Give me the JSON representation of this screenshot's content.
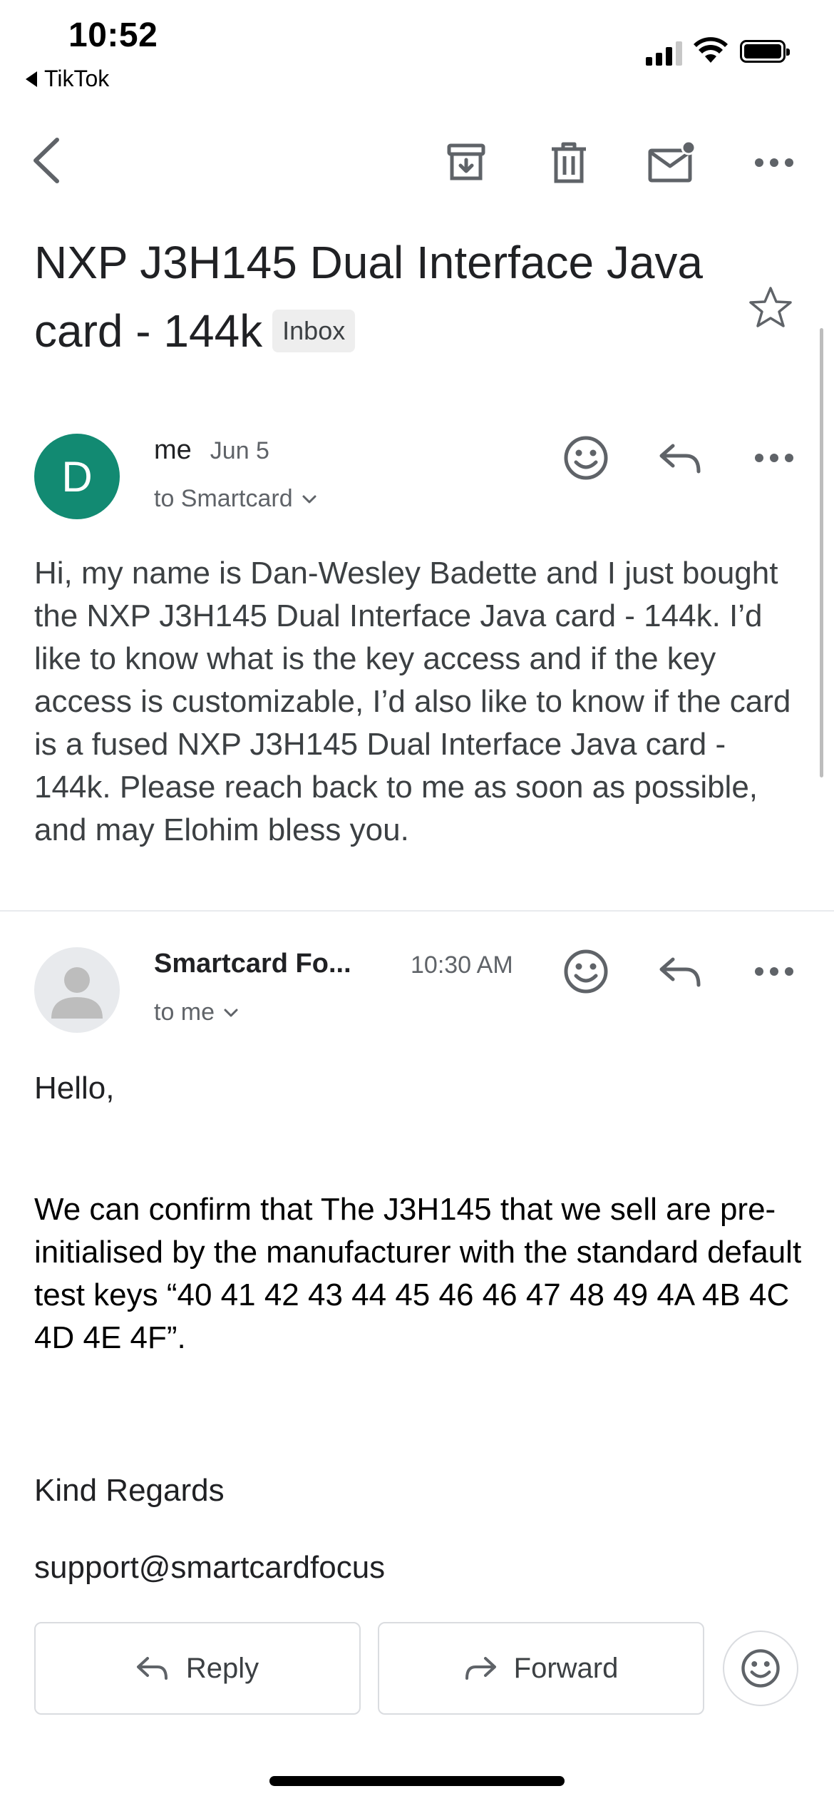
{
  "status_bar": {
    "time": "10:52",
    "back_app": "TikTok",
    "icons": [
      "cellular-signal-icon",
      "wifi-icon",
      "battery-icon"
    ]
  },
  "toolbar": {
    "icons": [
      "back-arrow-icon",
      "archive-icon",
      "trash-icon",
      "mark-unread-icon",
      "more-horizontal-icon"
    ]
  },
  "subject": {
    "line1": "NXP J3H145 Dual Interface Java",
    "line2": "card - 144k",
    "label": "Inbox"
  },
  "messages": [
    {
      "avatar_letter": "D",
      "avatar_color": "#128a72",
      "sender": "me",
      "date": "Jun 5",
      "recipient": "to Smartcard",
      "body": "Hi, my name is Dan-Wesley Badette and I just bought the NXP J3H145 Dual Interface Java card - 144k. I’d like to know what is the key access and if the key access is customizable, I’d also like to know if the card is a fused NXP J3H145 Dual Interface Java card - 144k. Please reach back to me as soon as possible, and may Elohim bless you."
    },
    {
      "sender": "Smartcard Fo...",
      "date": "10:30 AM",
      "recipient": "to me",
      "greeting": "Hello,",
      "paragraph": "We can confirm that The J3H145 that we sell are pre-initialised by the manufacturer with the standard default test keys “40 41 42 43 44 45 46 46 47 48 49 4A 4B 4C 4D 4E 4F”.",
      "signoff": "Kind Regards",
      "signature": "support@smartcardfocus"
    }
  ],
  "actions": {
    "reply": "Reply",
    "forward": "Forward"
  },
  "colors": {
    "accent_avatar": "#128a72",
    "icon_gray": "#5f6368",
    "border": "#dadce0"
  }
}
